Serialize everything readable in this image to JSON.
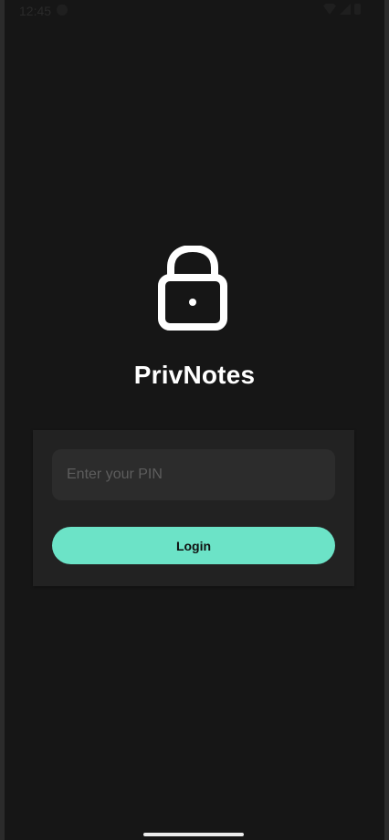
{
  "status_bar": {
    "time": "12:45",
    "left_icons": [
      "shield-icon"
    ],
    "right_icons": [
      "wifi-icon",
      "signal-icon",
      "battery-icon"
    ]
  },
  "app": {
    "title": "PrivNotes",
    "lock_icon": "lock-icon"
  },
  "login_form": {
    "pin_placeholder": "Enter your PIN",
    "login_label": "Login"
  },
  "colors": {
    "background": "#161616",
    "card": "#222222",
    "input": "#2c2c2c",
    "accent": "#6ce3c7",
    "text": "#ffffff"
  }
}
